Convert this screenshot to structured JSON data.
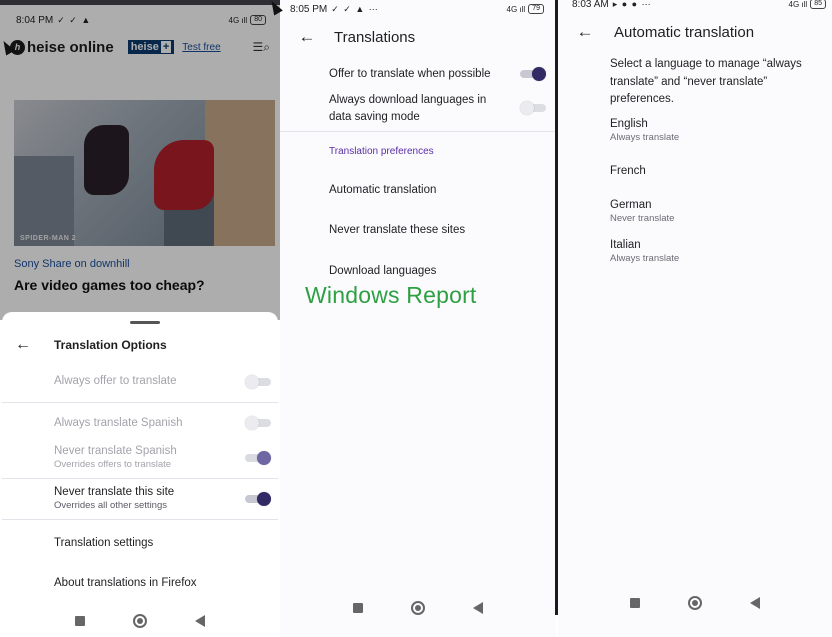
{
  "panel1": {
    "status": {
      "time": "8:04 PM",
      "icons": "✓ ✓ ▲",
      "signal": "4G ıll",
      "battery": "80"
    },
    "site": {
      "logo": "heise online",
      "plus_label": "heise",
      "plus_sign": "+",
      "test_free": "Test free"
    },
    "article": {
      "image_caption": "SPIDER-MAN 2",
      "kicker": "Sony Share on downhill",
      "headline": "Are video games too cheap?"
    },
    "sheet": {
      "title": "Translation Options",
      "options": [
        {
          "label": "Always offer to translate",
          "sub": "",
          "state": "off"
        },
        {
          "label": "Always translate Spanish",
          "sub": "",
          "state": "off"
        },
        {
          "label": "Never translate Spanish",
          "sub": "Overrides offers to translate",
          "state": "on-dim"
        },
        {
          "label": "Never translate this site",
          "sub": "Overrides all other settings",
          "state": "on"
        }
      ],
      "links": [
        "Translation settings",
        "About translations in Firefox"
      ]
    }
  },
  "panel2": {
    "status": {
      "time": "8:05 PM",
      "icons": "✓ ✓ ▲ ⋯",
      "signal": "4G ıll",
      "battery": "79"
    },
    "title": "Translations",
    "offer_label": "Offer to translate when possible",
    "offer_state": "on",
    "download_label": "Always download languages in data saving mode",
    "download_state": "off",
    "section": "Translation preferences",
    "items": [
      "Automatic translation",
      "Never translate these sites",
      "Download languages"
    ],
    "watermark": "Windows Report"
  },
  "panel3": {
    "status": {
      "time": "8:03 AM",
      "icons": "▸ ● ● ⋯",
      "signal": "4G ıll",
      "battery": "85"
    },
    "title": "Automatic translation",
    "description": "Select a language to manage “always translate” and “never translate” preferences.",
    "languages": [
      {
        "name": "English",
        "pref": "Always translate"
      },
      {
        "name": "French",
        "pref": ""
      },
      {
        "name": "German",
        "pref": "Never translate"
      },
      {
        "name": "Italian",
        "pref": "Always translate"
      }
    ]
  },
  "icons": {
    "back": "arrow-left-icon",
    "menu": "search-menu-icon",
    "nav": [
      "square-icon",
      "circle-icon",
      "triangle-left-icon"
    ]
  }
}
